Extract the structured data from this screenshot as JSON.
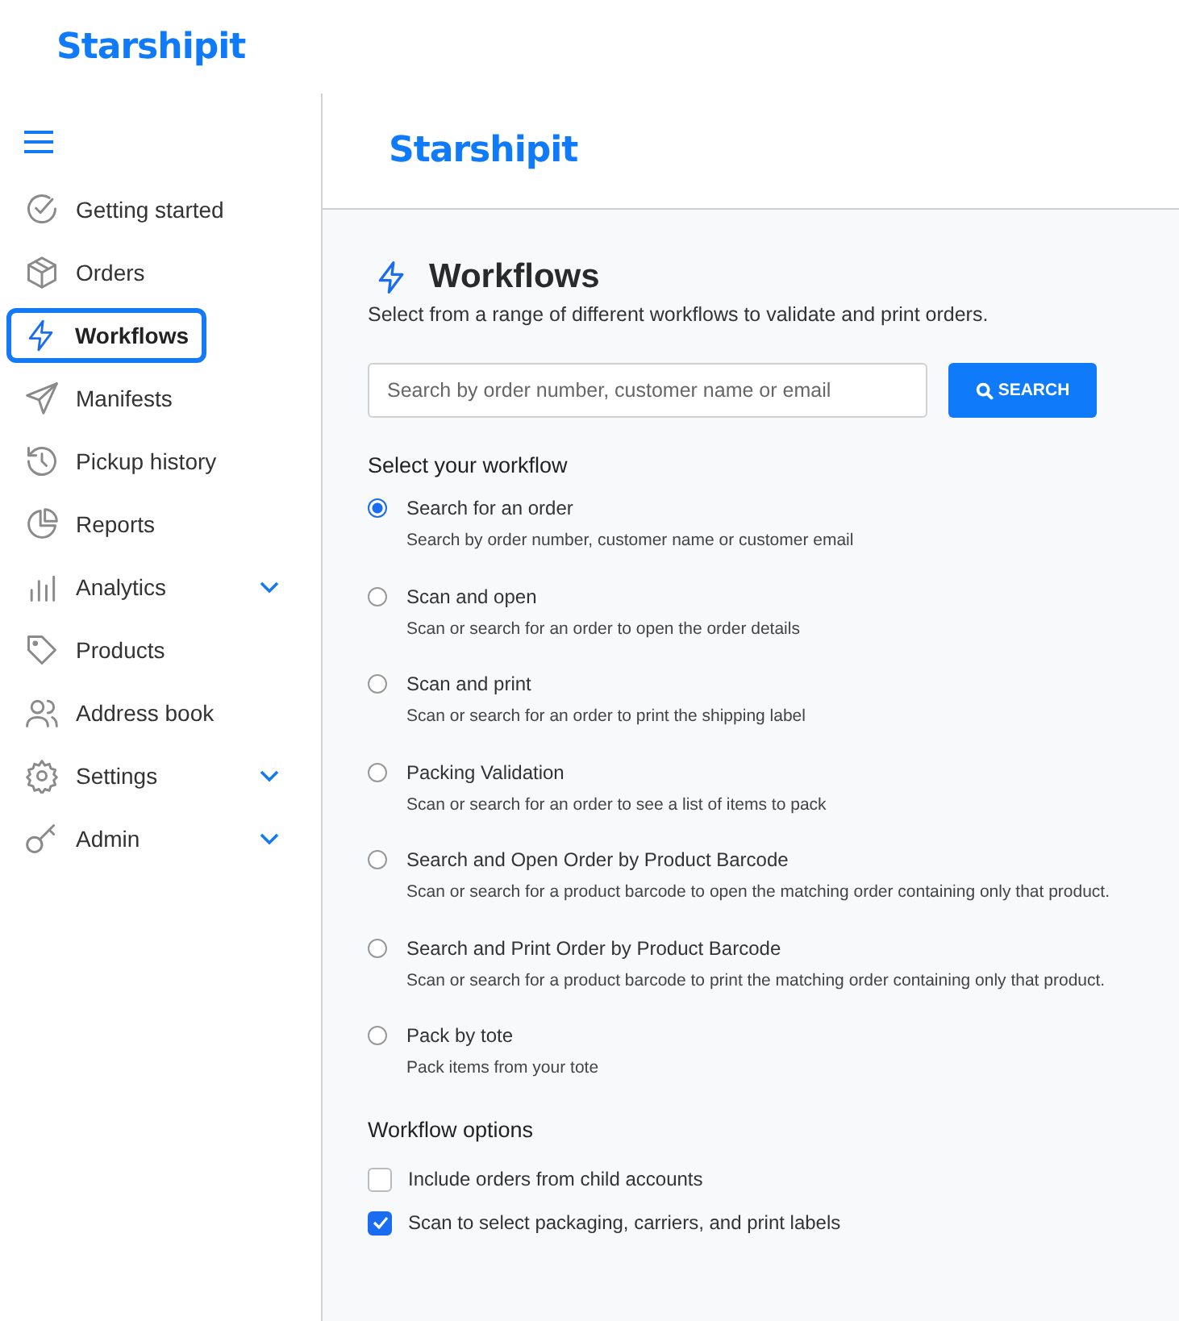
{
  "brand": "Starshipit",
  "sidebar": {
    "items": [
      {
        "label": "Getting started",
        "selected": false
      },
      {
        "label": "Orders",
        "selected": false
      },
      {
        "label": "Workflows",
        "selected": true
      },
      {
        "label": "Manifests",
        "selected": false
      },
      {
        "label": "Pickup history",
        "selected": false
      },
      {
        "label": "Reports",
        "selected": false
      },
      {
        "label": "Analytics",
        "selected": false,
        "expandable": true
      },
      {
        "label": "Products",
        "selected": false
      },
      {
        "label": "Address book",
        "selected": false
      },
      {
        "label": "Settings",
        "selected": false,
        "expandable": true
      },
      {
        "label": "Admin",
        "selected": false,
        "expandable": true
      }
    ]
  },
  "header": {
    "brand": "Starshipit"
  },
  "page": {
    "title": "Workflows",
    "subtitle": "Select from a range of different workflows to validate and print orders.",
    "search": {
      "placeholder": "Search by order number, customer name or email",
      "button": "SEARCH"
    },
    "workflow_heading": "Select your workflow",
    "workflows": [
      {
        "title": "Search for an order",
        "description": "Search by order number, customer name or customer email",
        "selected": true
      },
      {
        "title": "Scan and open",
        "description": "Scan or search for an order to open the order details",
        "selected": false
      },
      {
        "title": "Scan and print",
        "description": "Scan or search for an order to print the shipping label",
        "selected": false
      },
      {
        "title": "Packing Validation",
        "description": "Scan or search for an order to see a list of items to pack",
        "selected": false
      },
      {
        "title": "Search and Open Order by Product Barcode",
        "description": "Scan or search for a product barcode to open the matching order containing only that product.",
        "selected": false
      },
      {
        "title": "Search and Print Order by Product Barcode",
        "description": "Scan or search for a product barcode to print the matching order containing only that product.",
        "selected": false
      },
      {
        "title": "Pack by tote",
        "description": "Pack items from your tote",
        "selected": false
      }
    ],
    "options_heading": "Workflow options",
    "options": [
      {
        "label": "Include orders from child accounts",
        "checked": false
      },
      {
        "label": "Scan to select packaging, carriers, and print labels",
        "checked": true
      }
    ]
  }
}
